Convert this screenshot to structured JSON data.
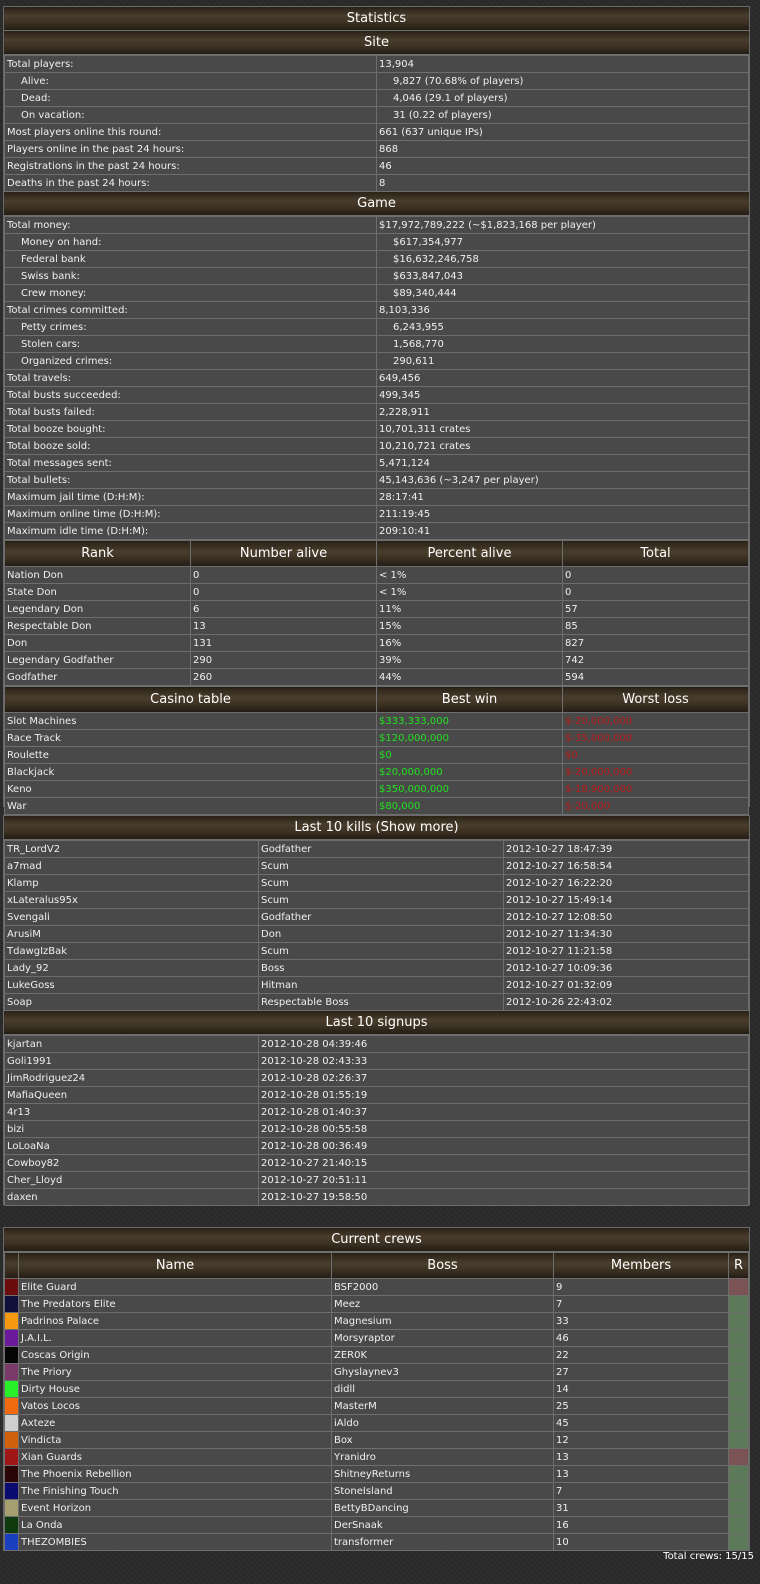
{
  "stats": {
    "title": "Statistics",
    "site_header": "Site",
    "site_rows": [
      {
        "label": "Total players:",
        "value": "13,904",
        "indent": false
      },
      {
        "label": "Alive:",
        "value": "9,827 (70.68% of players)",
        "indent": true
      },
      {
        "label": "Dead:",
        "value": "4,046 (29.1 of players)",
        "indent": true
      },
      {
        "label": "On vacation:",
        "value": "31 (0.22 of players)",
        "indent": true
      },
      {
        "label": "Most players online this round:",
        "value": "661 (637 unique IPs)",
        "indent": false
      },
      {
        "label": "Players online in the past 24 hours:",
        "value": "868",
        "indent": false
      },
      {
        "label": "Registrations in the past 24 hours:",
        "value": "46",
        "indent": false
      },
      {
        "label": "Deaths in the past 24 hours:",
        "value": "8",
        "indent": false
      }
    ],
    "game_header": "Game",
    "game_rows": [
      {
        "label": "Total money:",
        "value": "$17,972,789,222 (~$1,823,168 per player)",
        "indent": false
      },
      {
        "label": "Money on hand:",
        "value": "$617,354,977",
        "indent": true
      },
      {
        "label": "Federal bank",
        "value": "$16,632,246,758",
        "indent": true
      },
      {
        "label": "Swiss bank:",
        "value": "$633,847,043",
        "indent": true
      },
      {
        "label": "Crew money:",
        "value": "$89,340,444",
        "indent": true
      },
      {
        "label": "Total crimes committed:",
        "value": "8,103,336",
        "indent": false
      },
      {
        "label": "Petty crimes:",
        "value": "6,243,955",
        "indent": true
      },
      {
        "label": "Stolen cars:",
        "value": "1,568,770",
        "indent": true
      },
      {
        "label": "Organized crimes:",
        "value": "290,611",
        "indent": true
      },
      {
        "label": "Total travels:",
        "value": "649,456",
        "indent": false
      },
      {
        "label": "Total busts succeeded:",
        "value": "499,345",
        "indent": false
      },
      {
        "label": "Total busts failed:",
        "value": "2,228,911",
        "indent": false
      },
      {
        "label": "Total booze bought:",
        "value": "10,701,311 crates",
        "indent": false
      },
      {
        "label": "Total booze sold:",
        "value": "10,210,721 crates",
        "indent": false
      },
      {
        "label": "Total messages sent:",
        "value": "5,471,124",
        "indent": false
      },
      {
        "label": "Total bullets:",
        "value": "45,143,636 (~3,247 per player)",
        "indent": false
      },
      {
        "label": "Maximum jail time (D:H:M):",
        "value": "28:17:41",
        "indent": false
      },
      {
        "label": "Maximum online time (D:H:M):",
        "value": "211:19:45",
        "indent": false
      },
      {
        "label": "Maximum idle time (D:H:M):",
        "value": "209:10:41",
        "indent": false
      }
    ],
    "rank_headers": [
      "Rank",
      "Number alive",
      "Percent alive",
      "Total"
    ],
    "ranks": [
      [
        "Nation Don",
        "0",
        "< 1%",
        "0"
      ],
      [
        "State Don",
        "0",
        "< 1%",
        "0"
      ],
      [
        "Legendary Don",
        "6",
        "11%",
        "57"
      ],
      [
        "Respectable Don",
        "13",
        "15%",
        "85"
      ],
      [
        "Don",
        "131",
        "16%",
        "827"
      ],
      [
        "Legendary Godfather",
        "290",
        "39%",
        "742"
      ],
      [
        "Godfather",
        "260",
        "44%",
        "594"
      ]
    ],
    "casino_headers": [
      "Casino table",
      "Best win",
      "Worst loss"
    ],
    "casino": [
      [
        "Slot Machines",
        "$333,333,000",
        "$-20,000,000"
      ],
      [
        "Race Track",
        "$120,000,000",
        "$-35,000,000"
      ],
      [
        "Roulette",
        "$0",
        "$0"
      ],
      [
        "Blackjack",
        "$20,000,000",
        "$-20,000,000"
      ],
      [
        "Keno",
        "$350,000,000",
        "$-18,900,000"
      ],
      [
        "War",
        "$80,000",
        "$-20,000"
      ]
    ]
  },
  "kills": {
    "header": "Last 10 kills (Show more)",
    "rows": [
      [
        "TR_LordV2",
        "Godfather",
        "2012-10-27 18:47:39"
      ],
      [
        "a7mad",
        "Scum",
        "2012-10-27 16:58:54"
      ],
      [
        "Klamp",
        "Scum",
        "2012-10-27 16:22:20"
      ],
      [
        "xLateralus95x",
        "Scum",
        "2012-10-27 15:49:14"
      ],
      [
        "Svengali",
        "Godfather",
        "2012-10-27 12:08:50"
      ],
      [
        "ArusiM",
        "Don",
        "2012-10-27 11:34:30"
      ],
      [
        "TdawgIzBak",
        "Scum",
        "2012-10-27 11:21:58"
      ],
      [
        "Lady_92",
        "Boss",
        "2012-10-27 10:09:36"
      ],
      [
        "LukeGoss",
        "Hitman",
        "2012-10-27 01:32:09"
      ],
      [
        "Soap",
        "Respectable Boss",
        "2012-10-26 22:43:02"
      ]
    ]
  },
  "signups": {
    "header": "Last 10 signups",
    "rows": [
      [
        "kjartan",
        "2012-10-28 04:39:46"
      ],
      [
        "Goli1991",
        "2012-10-28 02:43:33"
      ],
      [
        "JimRodriguez24",
        "2012-10-28 02:26:37"
      ],
      [
        "MafiaQueen",
        "2012-10-28 01:55:19"
      ],
      [
        "4r13",
        "2012-10-28 01:40:37"
      ],
      [
        "bizi",
        "2012-10-28 00:55:58"
      ],
      [
        "LoLoaNa",
        "2012-10-28 00:36:49"
      ],
      [
        "Cowboy82",
        "2012-10-27 21:40:15"
      ],
      [
        "Cher_Lloyd",
        "2012-10-27 20:51:11"
      ],
      [
        "daxen",
        "2012-10-27 19:58:50"
      ]
    ]
  },
  "crews": {
    "header": "Current crews",
    "col_headers": [
      "Name",
      "Boss",
      "Members",
      "R"
    ],
    "rows": [
      {
        "color": "#6b0d0d",
        "name": "Elite Guard",
        "boss": "BSF2000",
        "members": "9",
        "r": "#7a5454"
      },
      {
        "color": "#0f0f3a",
        "name": "The Predators Elite",
        "boss": "Meez",
        "members": "7",
        "r": "#5c7a5a"
      },
      {
        "color": "#f59a10",
        "name": "Padrinos Palace",
        "boss": "Magnesium",
        "members": "33",
        "r": "#5c7a5a"
      },
      {
        "color": "#6a1a9a",
        "name": "J.A.I.L.",
        "boss": "Morsyraptor",
        "members": "46",
        "r": "#5c7a5a"
      },
      {
        "color": "#050505",
        "name": "Coscas Origin",
        "boss": "ZER0K",
        "members": "22",
        "r": "#5c7a5a"
      },
      {
        "color": "#7a3a6a",
        "name": "The Priory",
        "boss": "Ghyslaynev3",
        "members": "27",
        "r": "#5c7a5a"
      },
      {
        "color": "#28f028",
        "name": "Dirty House",
        "boss": "didll",
        "members": "14",
        "r": "#5c7a5a"
      },
      {
        "color": "#f06a10",
        "name": "Vatos Locos",
        "boss": "MasterM",
        "members": "25",
        "r": "#5c7a5a"
      },
      {
        "color": "#cfcfcf",
        "name": "Axteze",
        "boss": "iAldo",
        "members": "45",
        "r": "#5c7a5a"
      },
      {
        "color": "#d0600a",
        "name": "Vindicta",
        "boss": "Box",
        "members": "12",
        "r": "#5c7a5a"
      },
      {
        "color": "#a01515",
        "name": "Xian Guards",
        "boss": "Yranidro",
        "members": "13",
        "r": "#7a5454"
      },
      {
        "color": "#2a0505",
        "name": "The Phoenix Rebellion",
        "boss": "ShitneyReturns",
        "members": "13",
        "r": "#5c7a5a"
      },
      {
        "color": "#0a0a70",
        "name": "The Finishing Touch",
        "boss": "StoneIsland",
        "members": "7",
        "r": "#5c7a5a"
      },
      {
        "color": "#a6a070",
        "name": "Event Horizon",
        "boss": "BettyBDancing",
        "members": "31",
        "r": "#5c7a5a"
      },
      {
        "color": "#0e3a0e",
        "name": "La Onda",
        "boss": "DerSnaak",
        "members": "16",
        "r": "#5c7a5a"
      },
      {
        "color": "#1a40c0",
        "name": "THEZOMBIES",
        "boss": "transformer",
        "members": "10",
        "r": "#5c7a5a"
      }
    ],
    "footer": "Total crews: 15/15"
  }
}
